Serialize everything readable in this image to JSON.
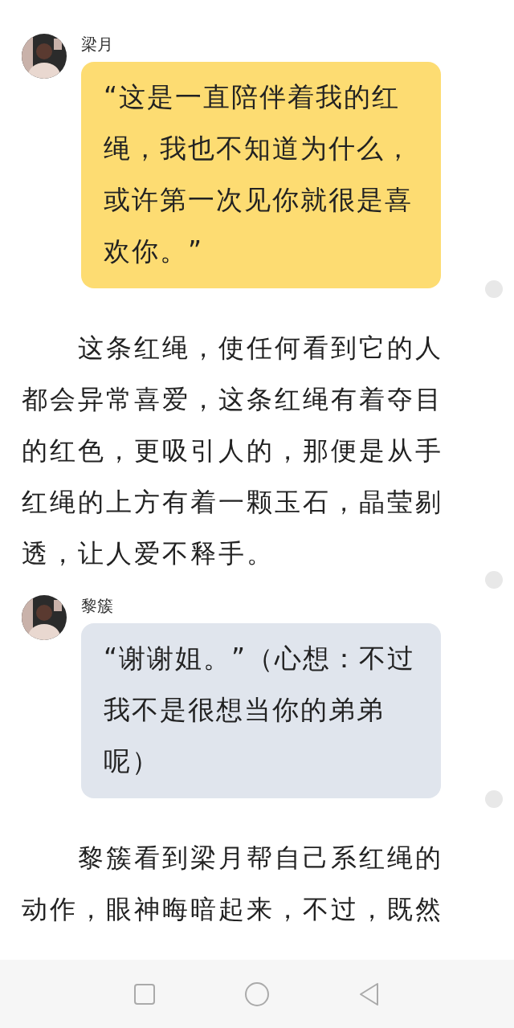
{
  "blocks": [
    {
      "kind": "dialogue",
      "speaker": "梁月",
      "color": "#fddc72",
      "text": "“这是一直陪伴着我的红绳，我也不知道为什么，或许第一次见你就很是喜欢你。”",
      "marked": true
    },
    {
      "kind": "narration",
      "text": "这条红绳，使任何看到它的人都会异常喜爱，这条红绳有着夺目的红色，更吸引人的，那便是从手红绳的上方有着一颗玉石，晶莹剔透，让人爱不释手。",
      "marked": true
    },
    {
      "kind": "dialogue",
      "speaker": "黎簇",
      "color": "#e0e5ed",
      "text": "“谢谢姐。”（心想：不过我不是很想当你的弟弟呢）",
      "marked": true
    },
    {
      "kind": "narration",
      "text": "黎簇看到梁月帮自己系红绳的动作，眼神晦暗起来，不过，既然",
      "marked": false
    }
  ]
}
